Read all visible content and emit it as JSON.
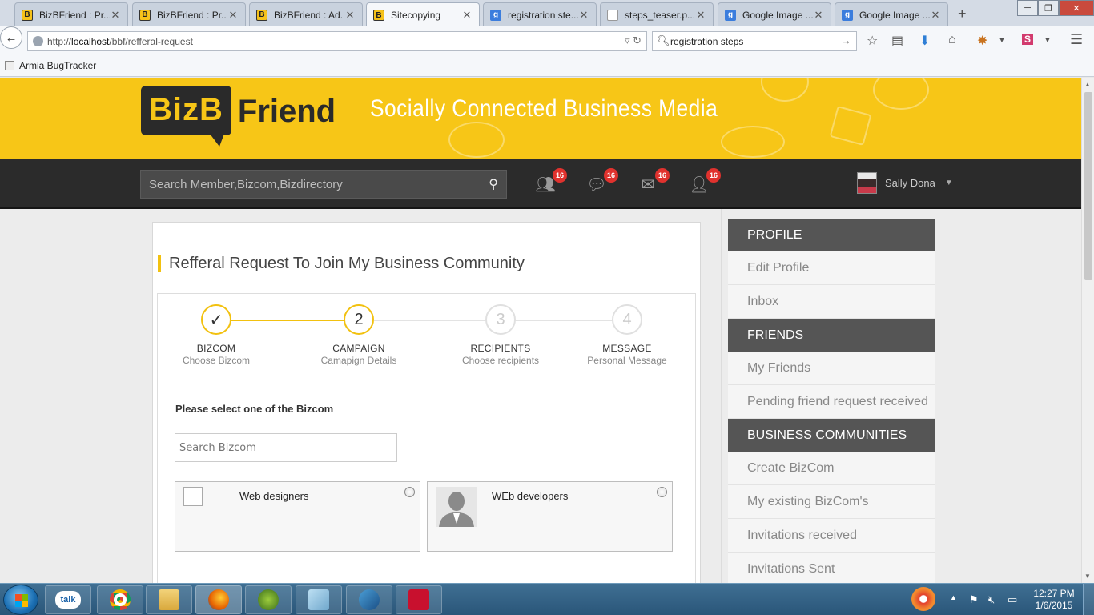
{
  "browser": {
    "tabs": [
      {
        "label": "BizBFriend : Pr...",
        "favicon": "b",
        "active": false
      },
      {
        "label": "BizBFriend : Pr...",
        "favicon": "b",
        "active": false
      },
      {
        "label": "BizBFriend : Ad...",
        "favicon": "b",
        "active": false
      },
      {
        "label": "Sitecopying",
        "favicon": "b",
        "active": true
      },
      {
        "label": "registration ste...",
        "favicon": "g",
        "active": false
      },
      {
        "label": "steps_teaser.p...",
        "favicon": "doc",
        "active": false
      },
      {
        "label": "Google Image ...",
        "favicon": "g",
        "active": false
      },
      {
        "label": "Google Image ...",
        "favicon": "g",
        "active": false
      }
    ],
    "url_prefix": "http://",
    "url_host": "localhost",
    "url_path": "/bbf/refferal-request",
    "search_value": "registration steps",
    "bookmark": "Armia BugTracker"
  },
  "site": {
    "logo_box": "BizB",
    "logo_text": "Friend",
    "tagline": "Socially Connected Business Media",
    "search_placeholder": "Search Member,Bizcom,Bizdirectory",
    "notifications": [
      {
        "icon": "friend-requests-icon",
        "count": "16"
      },
      {
        "icon": "chat-icon",
        "count": "16"
      },
      {
        "icon": "mail-icon",
        "count": "16"
      },
      {
        "icon": "add-user-icon",
        "count": "16"
      }
    ],
    "user_name": "Sally Dona"
  },
  "main": {
    "title": "Refferal Request To Join My Business Community",
    "steps": [
      {
        "num": "✓",
        "name": "BIZCOM",
        "sub": "Choose Bizcom",
        "state": "done"
      },
      {
        "num": "2",
        "name": "CAMPAIGN",
        "sub": "Camapign Details",
        "state": "current"
      },
      {
        "num": "3",
        "name": "RECIPIENTS",
        "sub": "Choose recipients",
        "state": "pending"
      },
      {
        "num": "4",
        "name": "MESSAGE",
        "sub": "Personal Message",
        "state": "pending"
      }
    ],
    "select_label": "Please select one of the Bizcom",
    "bizcom_search_placeholder": "Search Bizcom",
    "bizcoms": [
      {
        "name": "Web designers"
      },
      {
        "name": "WEb developers"
      }
    ]
  },
  "sidebar": {
    "sections": [
      {
        "title": "PROFILE",
        "items": [
          "Edit Profile",
          "Inbox"
        ]
      },
      {
        "title": "FRIENDS",
        "items": [
          "My Friends",
          "Pending friend request received"
        ]
      },
      {
        "title": "BUSINESS COMMUNITIES",
        "items": [
          "Create BizCom",
          "My existing BizCom's",
          "Invitations received",
          "Invitations Sent"
        ]
      }
    ]
  },
  "taskbar": {
    "time": "12:27 PM",
    "date": "1/6/2015",
    "talk_label": "talk"
  },
  "colors": {
    "brand_yellow": "#f7c617",
    "accent_yellow": "#f2c110",
    "dark_bar": "#2b2b2b",
    "badge_red": "#e0322e",
    "sidebar_head": "#555555"
  }
}
